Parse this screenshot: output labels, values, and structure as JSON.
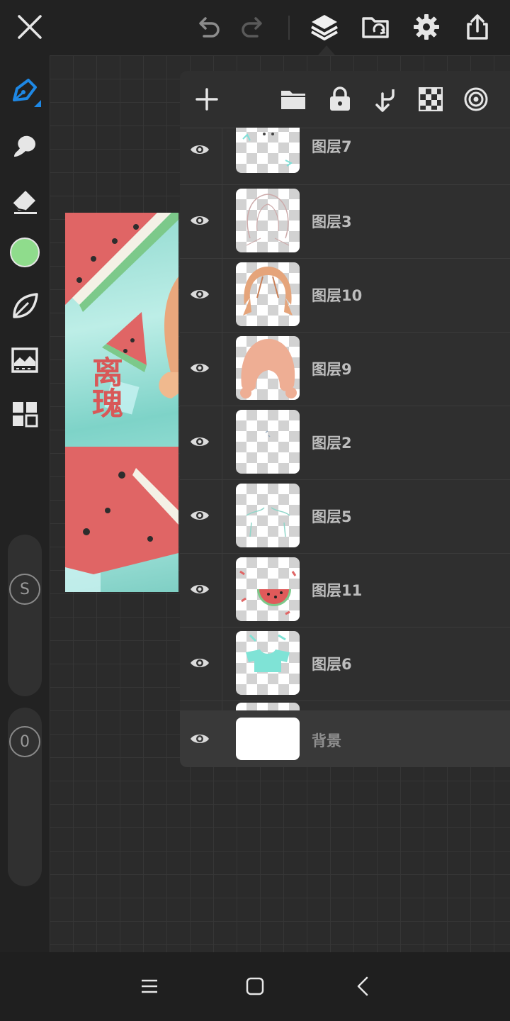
{
  "topbar": {
    "close_icon": "close-icon",
    "undo_icon": "undo-icon",
    "redo_icon": "redo-icon",
    "layers_icon": "layers-icon",
    "gallery_icon": "folder-sync-icon",
    "settings_icon": "gear-icon",
    "share_icon": "share-icon"
  },
  "tools": [
    {
      "name": "pen",
      "icon": "pen-icon",
      "active": true
    },
    {
      "name": "smudge",
      "icon": "smudge-icon"
    },
    {
      "name": "eraser",
      "icon": "eraser-icon"
    },
    {
      "name": "color",
      "icon": "color-swatch-icon",
      "color": "#8fdc8c"
    },
    {
      "name": "leaf",
      "icon": "leaf-icon"
    },
    {
      "name": "layer-preview",
      "icon": "image-icon"
    },
    {
      "name": "grid-menu",
      "icon": "grid-icon"
    }
  ],
  "size_slider": {
    "label": "S"
  },
  "opacity_slider": {
    "label": "0"
  },
  "artwork": {
    "title": "离瑰"
  },
  "layer_panel": {
    "header_icons": [
      "plus-icon",
      "folder-icon",
      "lock-icon",
      "merge-down-icon",
      "checkerboard-icon",
      "target-icon"
    ],
    "layers": [
      {
        "name": "图层7"
      },
      {
        "name": "图层3"
      },
      {
        "name": "图层10"
      },
      {
        "name": "图层9"
      },
      {
        "name": "图层2"
      },
      {
        "name": "图层5"
      },
      {
        "name": "图层11"
      },
      {
        "name": "图层6"
      }
    ],
    "background_layer": {
      "name": "背景"
    }
  },
  "navbar": {
    "menu_icon": "menu-icon",
    "home_icon": "home-icon",
    "back_icon": "back-icon"
  },
  "colors": {
    "accent": "#1e88e5",
    "selected_color": "#8fdc8c",
    "watermelon": "#e06565"
  }
}
